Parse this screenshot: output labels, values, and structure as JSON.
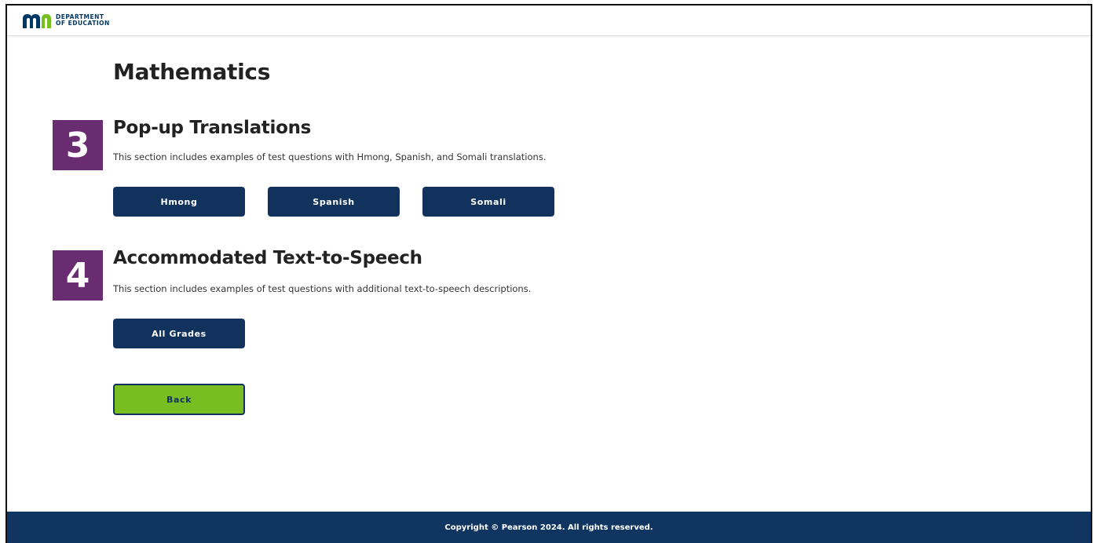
{
  "header": {
    "logo_line1": "DEPARTMENT",
    "logo_line2": "OF EDUCATION",
    "logo_icon": "mn-logo-icon",
    "colors": {
      "navy": "#003865",
      "green": "#78be21"
    }
  },
  "main": {
    "title": "Mathematics",
    "sections": [
      {
        "number": "3",
        "title": "Pop-up Translations",
        "description": "This section includes examples of test questions with Hmong, Spanish, and Somali translations.",
        "buttons": [
          "Hmong",
          "Spanish",
          "Somali"
        ]
      },
      {
        "number": "4",
        "title": "Accommodated Text-to-Speech",
        "description": "This section includes examples of test questions with additional text-to-speech descriptions.",
        "buttons": [
          "All Grades"
        ]
      }
    ],
    "back_label": "Back"
  },
  "footer": {
    "copyright": "Copyright © Pearson 2024. All rights reserved."
  },
  "colors": {
    "badge": "#6a2c70",
    "button": "#12325e",
    "back_button": "#78be21",
    "footer": "#0f3560"
  }
}
